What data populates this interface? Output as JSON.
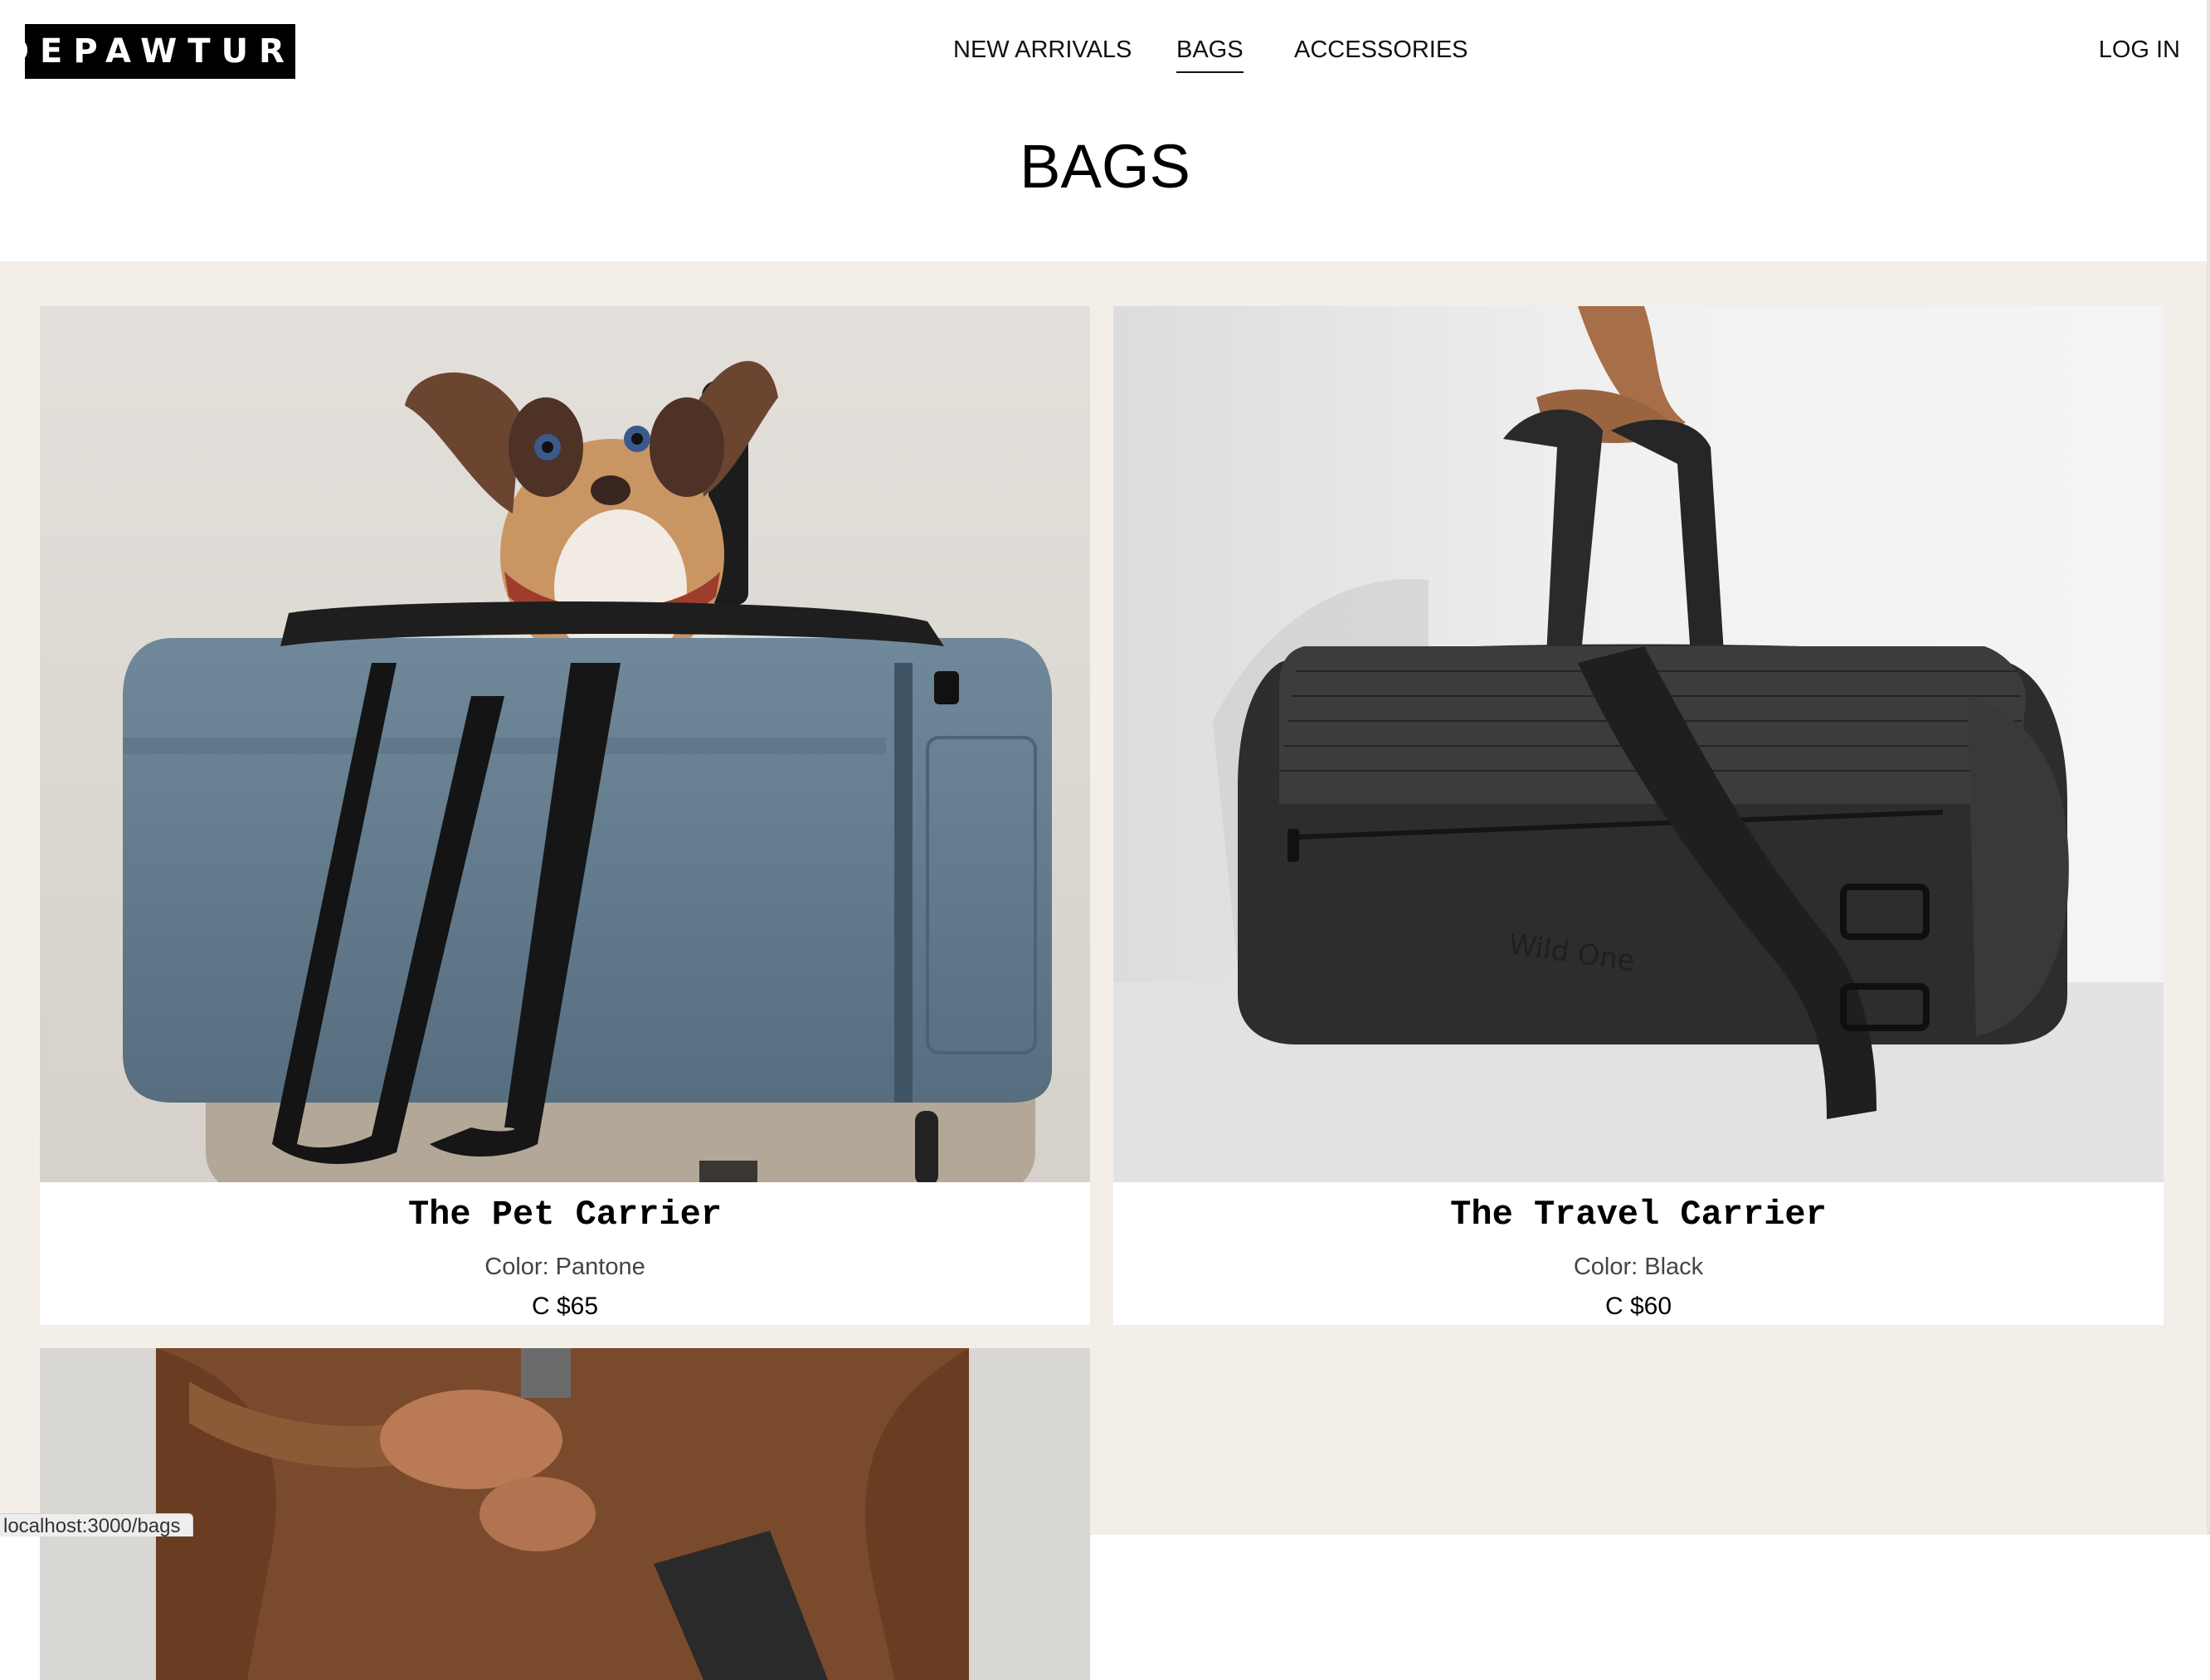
{
  "brand": {
    "logo_text": "DEPAWTURE"
  },
  "nav": {
    "items": [
      {
        "label": "NEW ARRIVALS",
        "active": false
      },
      {
        "label": "BAGS",
        "active": true
      },
      {
        "label": "ACCESSORIES",
        "active": false
      }
    ],
    "login_label": "LOG IN"
  },
  "page": {
    "title": "BAGS"
  },
  "products": [
    {
      "name": "The Pet Carrier",
      "color": "Color: Pantone",
      "price": "C $65"
    },
    {
      "name": "The Travel Carrier",
      "color": "Color: Black",
      "price": "C $60"
    },
    {
      "name": "",
      "color": "",
      "price": ""
    }
  ],
  "status_bar": {
    "url": "localhost:3000/bags"
  },
  "colors": {
    "background": "#f3efe8",
    "card": "#ffffff",
    "logo_bg": "#000000",
    "pantone_bag": "#61798c",
    "black_bag": "#2b2b2b"
  }
}
